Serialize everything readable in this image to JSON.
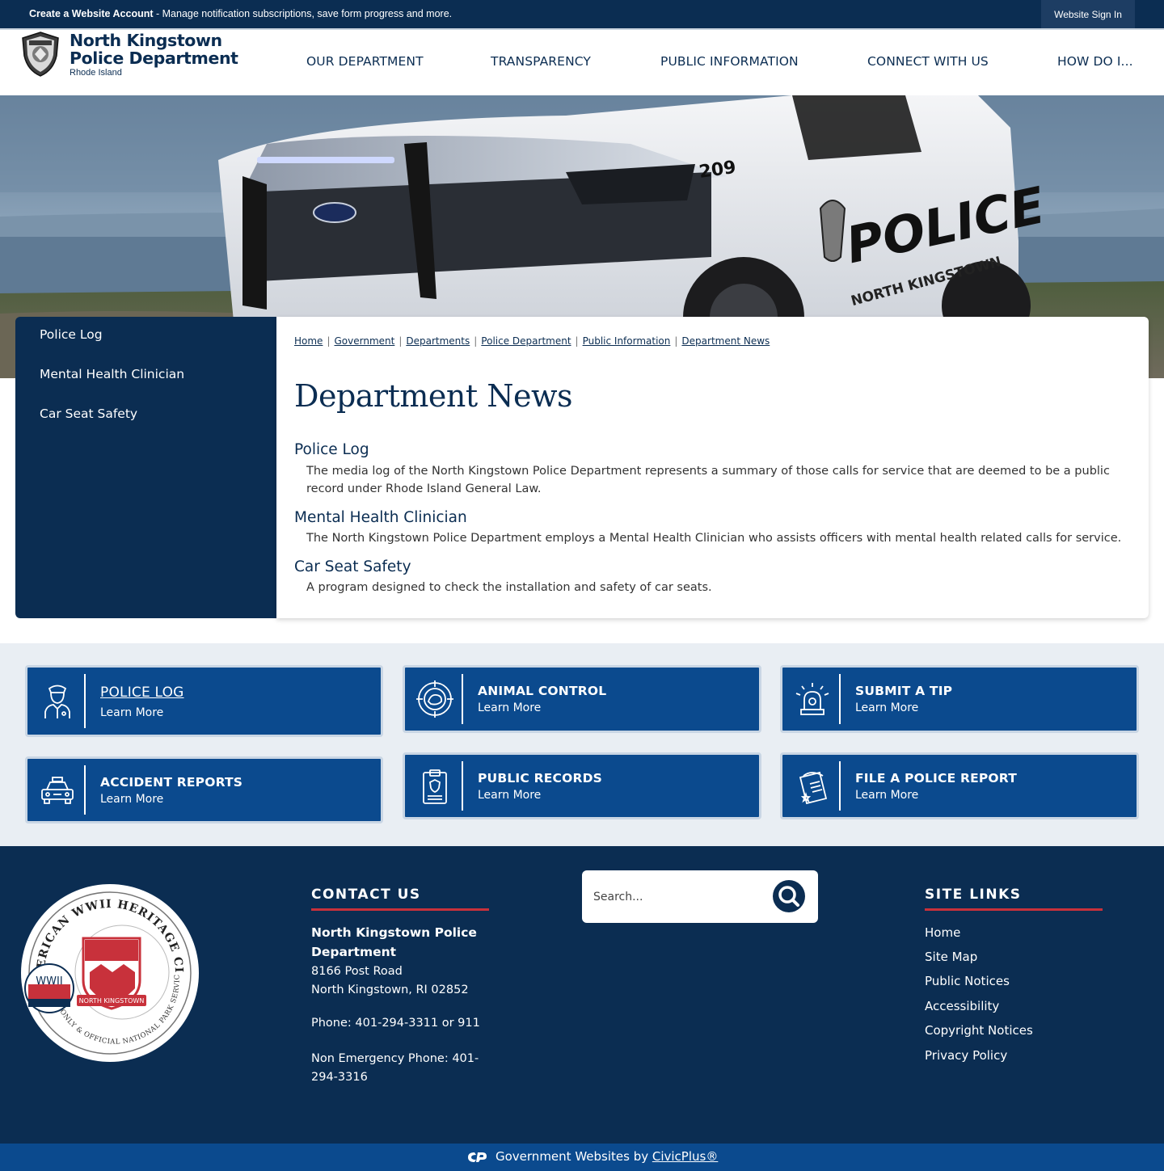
{
  "top_bar": {
    "create_account_bold": "Create a Website Account",
    "create_account_text": " - Manage notification subscriptions, save form progress and more.",
    "sign_in": "Website Sign In"
  },
  "brand": {
    "line1": "North Kingstown",
    "line2": "Police Department",
    "line3": "Rhode Island"
  },
  "nav": [
    "OUR DEPARTMENT",
    "TRANSPARENCY",
    "PUBLIC INFORMATION",
    "CONNECT WITH US",
    "HOW DO I..."
  ],
  "hero": {
    "unit_number": "209",
    "door_text": "POLICE",
    "door_subtext": "NORTH KINGSTOWN"
  },
  "sidebar": {
    "items": [
      "Police Log",
      "Mental Health Clinician",
      "Car Seat Safety"
    ]
  },
  "breadcrumb": [
    "Home",
    "Government",
    "Departments",
    "Police Department",
    "Public Information",
    "Department News"
  ],
  "page_title": "Department News",
  "news": [
    {
      "title": "Police Log",
      "description": "The media log of the North Kingstown Police Department represents a summary of those calls for service that are deemed to be a public record under Rhode Island General Law."
    },
    {
      "title": "Mental Health Clinician",
      "description": "The North Kingstown Police Department employs a Mental Health Clinician who assists officers with mental health related calls for service."
    },
    {
      "title": "Car Seat Safety",
      "description": "A program designed to check the installation and safety of car seats."
    }
  ],
  "quick_links": [
    {
      "title": "POLICE LOG",
      "sub": "Learn More",
      "icon": "police-officer-icon"
    },
    {
      "title": "ANIMAL CONTROL",
      "sub": "Learn More",
      "icon": "animal-control-icon"
    },
    {
      "title": "SUBMIT A TIP",
      "sub": "Learn More",
      "icon": "siren-icon"
    },
    {
      "title": "ACCIDENT REPORTS",
      "sub": "Learn More",
      "icon": "police-car-icon"
    },
    {
      "title": "PUBLIC RECORDS",
      "sub": "Learn More",
      "icon": "clipboard-badge-icon"
    },
    {
      "title": "FILE A POLICE REPORT",
      "sub": "Learn More",
      "icon": "report-document-icon"
    }
  ],
  "footer": {
    "seal": {
      "ring_text_top": "AMERICAN WWII HERITAGE CITY",
      "ring_text_bottom": "RHODE ISLAND'S ONLY & OFFICIAL NATIONAL PARK SERVICE DESIGNEE",
      "wwii": "WWII",
      "town": "NORTH KINGSTOWN"
    },
    "contact_heading": "CONTACT US",
    "contact_name": "North Kingstown Police Department",
    "address1": "8166 Post Road",
    "address2": "North Kingstown, RI 02852",
    "phone": "Phone: 401-294-3311 or 911",
    "non_emergency": "Non Emergency Phone: 401-294-3316",
    "search_placeholder": "Search...",
    "site_links_heading": "SITE LINKS",
    "site_links": [
      "Home",
      "Site Map",
      "Public Notices",
      "Accessibility",
      "Copyright Notices",
      "Privacy Policy"
    ]
  },
  "bottom_bar": {
    "text": "Government Websites by ",
    "link": "CivicPlus®"
  },
  "colors": {
    "navy": "#0b2d52",
    "button_blue": "#0b4a8e",
    "accent_red": "#c8313b"
  }
}
